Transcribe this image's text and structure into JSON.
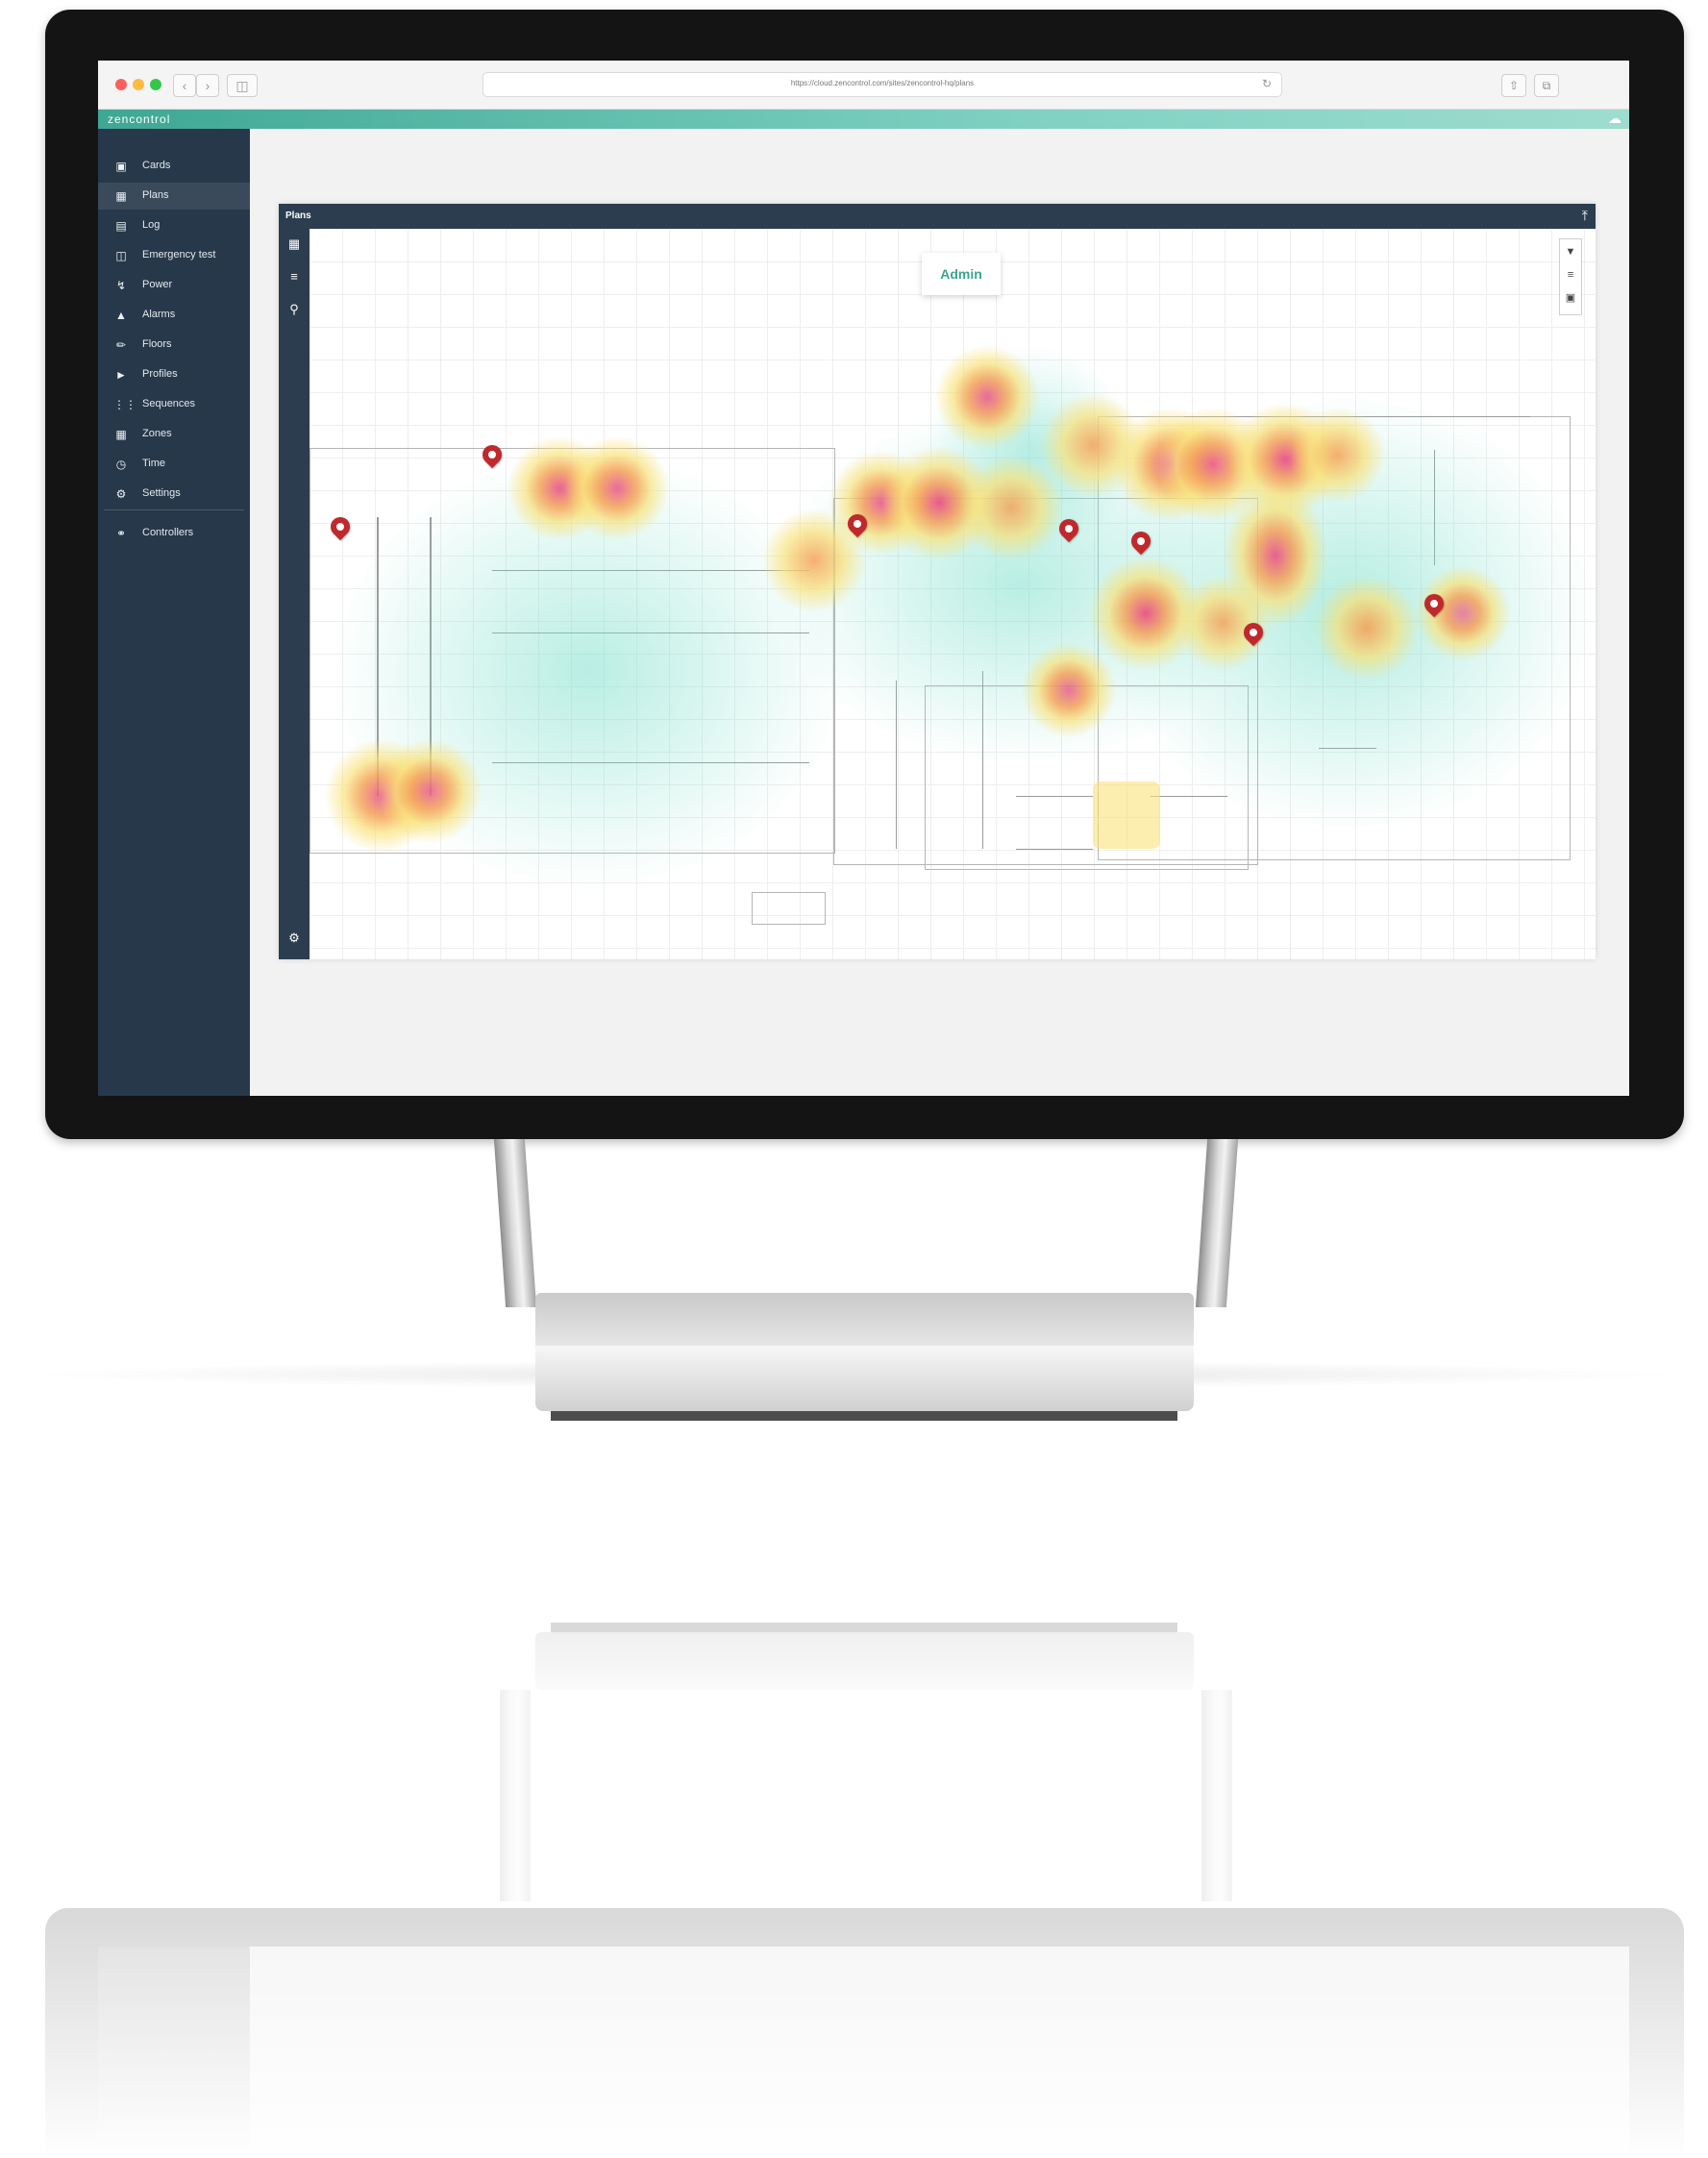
{
  "browser": {
    "url": "https://cloud.zencontrol.com/sites/zencontrol-hq/plans",
    "back_icon": "chevron-left-icon",
    "forward_icon": "chevron-right-icon",
    "reload_icon": "reload-icon"
  },
  "app": {
    "brand": "zencontrol",
    "accent_color": "#3ea794",
    "sidebar_color": "#27384a"
  },
  "sidebar": {
    "items": [
      {
        "label": "Cards",
        "icon": "cards-icon",
        "active": false
      },
      {
        "label": "Plans",
        "icon": "map-icon",
        "active": true
      },
      {
        "label": "Log",
        "icon": "log-icon",
        "active": false
      },
      {
        "label": "Emergency test",
        "icon": "emergency-icon",
        "active": false
      },
      {
        "label": "Power",
        "icon": "lightning-icon",
        "active": false
      },
      {
        "label": "Alarms",
        "icon": "warning-icon",
        "active": false
      },
      {
        "label": "Floors",
        "icon": "pencil-icon",
        "active": false
      },
      {
        "label": "Profiles",
        "icon": "tag-icon",
        "active": false
      },
      {
        "label": "Sequences",
        "icon": "sequence-icon",
        "active": false
      },
      {
        "label": "Zones",
        "icon": "grid-icon",
        "active": false
      },
      {
        "label": "Time",
        "icon": "clock-icon",
        "active": false
      },
      {
        "label": "Settings",
        "icon": "gear-icon",
        "active": false
      }
    ],
    "footer_item": {
      "label": "Controllers",
      "icon": "controllers-icon"
    }
  },
  "plans_panel": {
    "title": "Plans",
    "overlay_label": "Admin",
    "heatmap_scale": [
      "#7fe0cc",
      "#f9e27a",
      "#f4a25a",
      "#e8528a"
    ]
  }
}
